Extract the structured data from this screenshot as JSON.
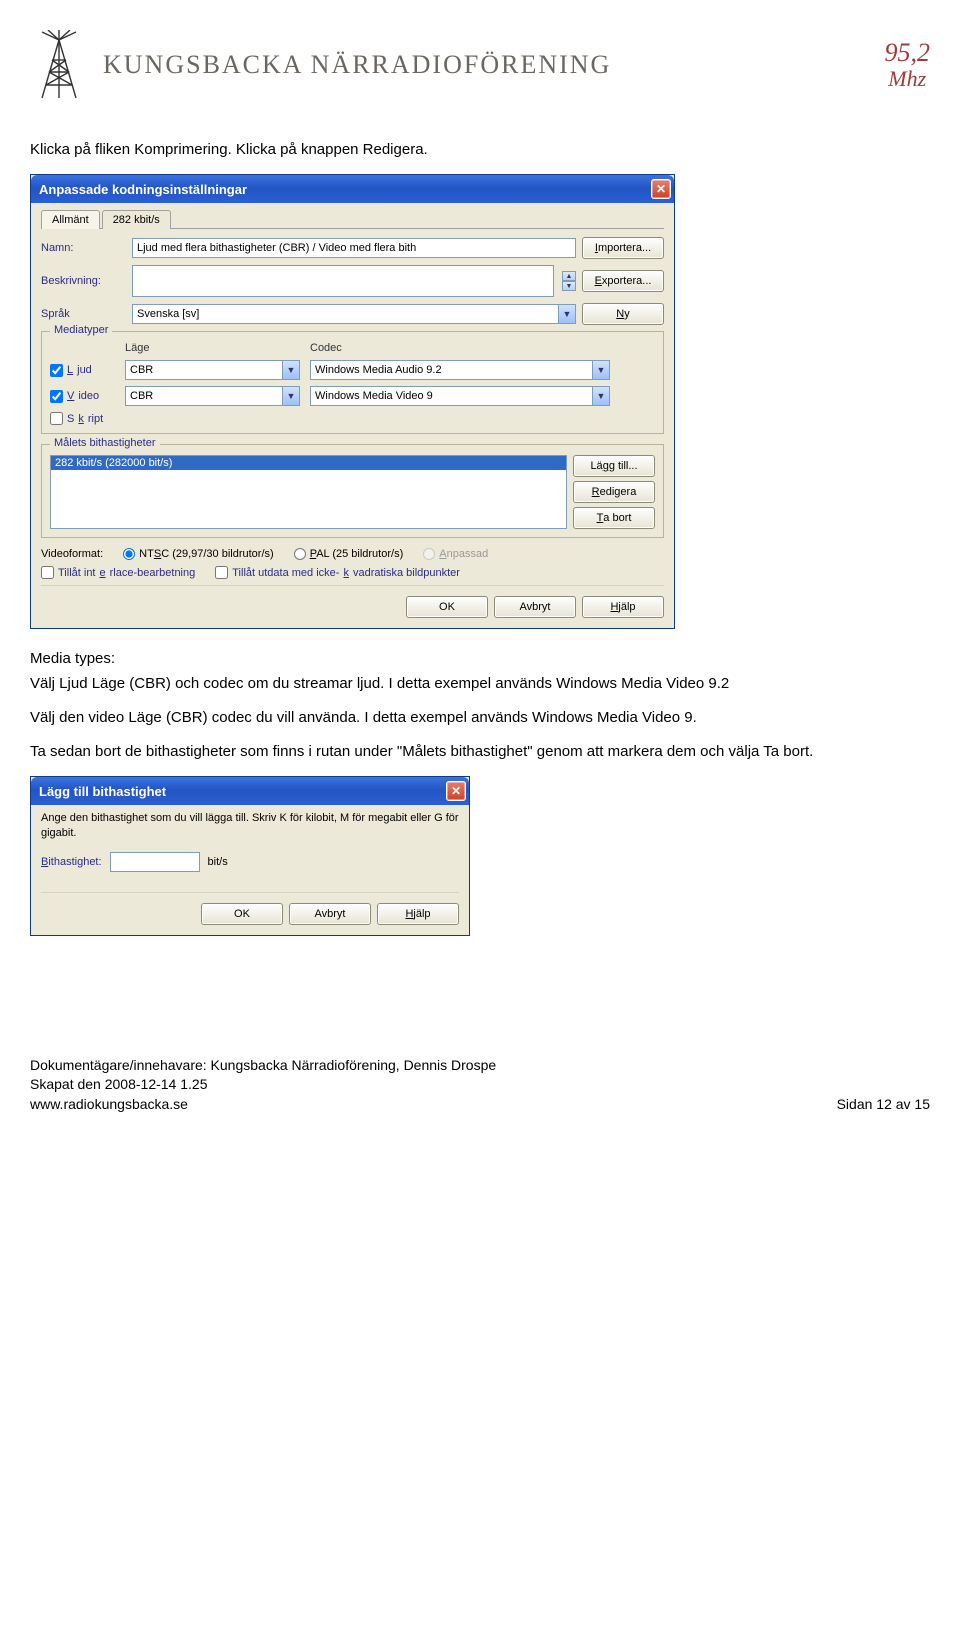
{
  "header": {
    "org": "KUNGSBACKA NÄRRADIOFÖRENING",
    "freq_value": "95,2",
    "freq_unit": "Mhz"
  },
  "intro1": "Klicka på fliken Komprimering. Klicka på knappen Redigera.",
  "dialog1": {
    "title": "Anpassade kodningsinställningar",
    "tabs": [
      "Allmänt",
      "282 kbit/s"
    ],
    "labels": {
      "name": "Namn:",
      "desc": "Beskrivning:",
      "lang": "Språk"
    },
    "values": {
      "name": "Ljud med flera bithastigheter (CBR) / Video med flera bith",
      "lang": "Svenska [sv]"
    },
    "buttons": {
      "import": "Importera...",
      "export": "Exportera...",
      "new": "Ny"
    },
    "media": {
      "legend": "Mediatyper",
      "col_mode": "Läge",
      "col_codec": "Codec",
      "audio_label": "Ljud",
      "video_label": "Video",
      "script_label": "Skript",
      "audio_mode": "CBR",
      "video_mode": "CBR",
      "audio_codec": "Windows Media Audio 9.2",
      "video_codec": "Windows Media Video 9"
    },
    "bitrate": {
      "legend": "Målets bithastigheter",
      "item": "282 kbit/s (282000 bit/s)",
      "add": "Lägg till...",
      "edit": "Redigera",
      "remove": "Ta bort"
    },
    "vf": {
      "label": "Videoformat:",
      "ntsc": "NTSC (29,97/30 bildrutor/s)",
      "pal": "PAL (25 bildrutor/s)",
      "custom": "Anpassad",
      "interlace": "Tillåt interlace-bearbetning",
      "nonsquare": "Tillåt utdata med icke-kvadratiska bildpunkter"
    },
    "bottom": {
      "ok": "OK",
      "cancel": "Avbryt",
      "help": "Hjälp"
    }
  },
  "body2": {
    "line1": "Media types:",
    "line2": "Välj Ljud Läge (CBR) och codec om du streamar ljud. I detta exempel används Windows Media Video 9.2",
    "line3": "Välj den video Läge (CBR) codec du vill använda. I detta exempel används Windows Media Video 9.",
    "line4": "Ta sedan bort de bithastigheter som finns i rutan under \"Målets bithastighet\" genom att markera dem och välja Ta bort."
  },
  "dialog2": {
    "title": "Lägg till bithastighet",
    "intro": "Ange den bithastighet som du vill lägga till. Skriv K för kilobit, M för megabit eller G för gigabit.",
    "label": "Bithastighet:",
    "unit": "bit/s",
    "ok": "OK",
    "cancel": "Avbryt",
    "help": "Hjälp"
  },
  "footer": {
    "owner": "Dokumentägare/innehavare: Kungsbacka Närradioförening, Dennis Drospe",
    "created": "Skapat den 2008-12-14 1.25",
    "page": "Sidan 12 av 15",
    "url": "www.radiokungsbacka.se"
  }
}
